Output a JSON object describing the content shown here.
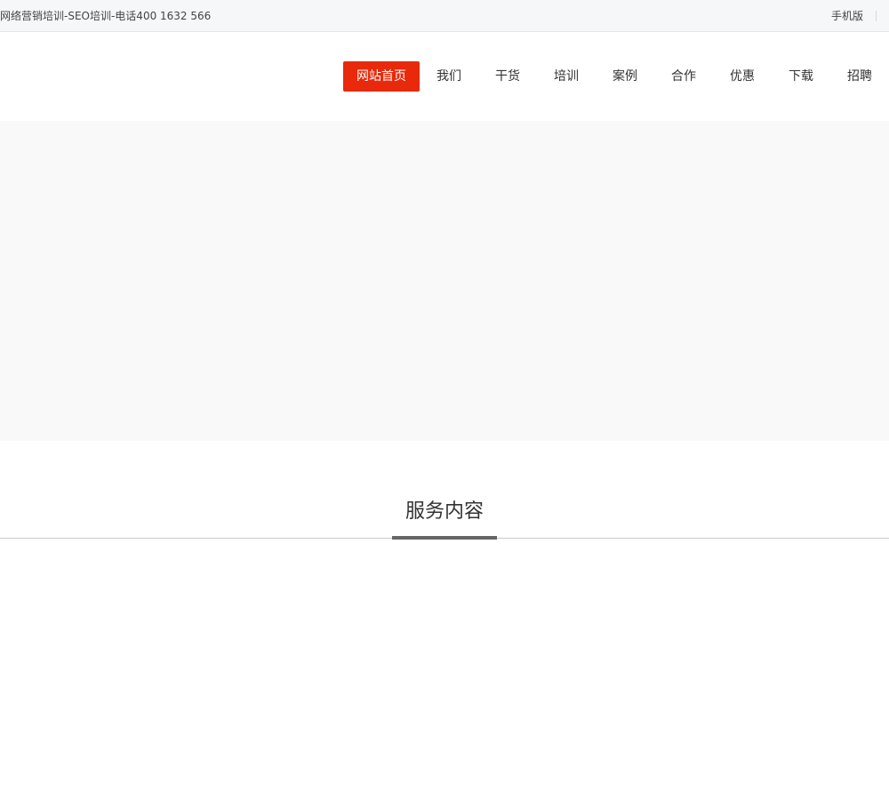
{
  "topbar": {
    "site_tagline": "网络营销培训-SEO培训-电话400 1632 566",
    "mobile_label": "手机版"
  },
  "nav": {
    "items": [
      {
        "label": "网站首页",
        "active": true
      },
      {
        "label": "我们"
      },
      {
        "label": "干货"
      },
      {
        "label": "培训"
      },
      {
        "label": "案例"
      },
      {
        "label": "合作"
      },
      {
        "label": "优惠"
      },
      {
        "label": "下载"
      },
      {
        "label": "招聘"
      }
    ]
  },
  "services": {
    "title": "服务内容"
  },
  "colors": {
    "accent": "#e8290b",
    "topbar_bg": "#f6f7f9",
    "banner_bg": "#f9f9f9",
    "section_underline": "#666666"
  }
}
